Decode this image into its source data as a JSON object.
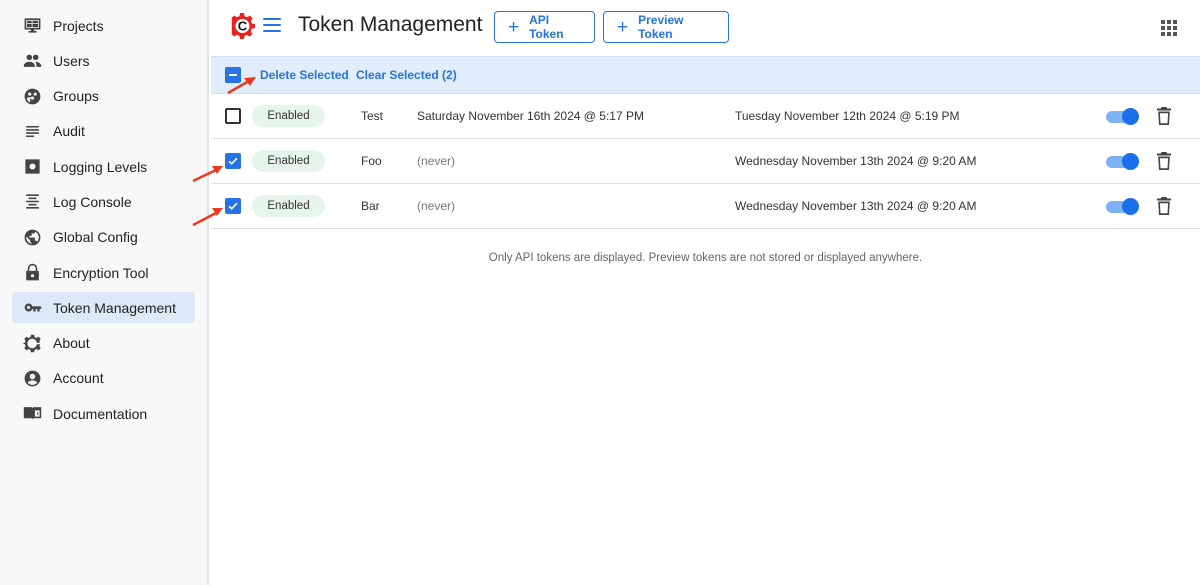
{
  "sidebar": {
    "items": [
      {
        "label": "Projects",
        "icon": "projects-icon",
        "active": false
      },
      {
        "label": "Users",
        "icon": "users-icon",
        "active": false
      },
      {
        "label": "Groups",
        "icon": "groups-icon",
        "active": false
      },
      {
        "label": "Audit",
        "icon": "audit-icon",
        "active": false
      },
      {
        "label": "Logging Levels",
        "icon": "logging-levels-icon",
        "active": false
      },
      {
        "label": "Log Console",
        "icon": "log-console-icon",
        "active": false
      },
      {
        "label": "Global Config",
        "icon": "globe-icon",
        "active": false
      },
      {
        "label": "Encryption Tool",
        "icon": "lock-icon",
        "active": false
      },
      {
        "label": "Token Management",
        "icon": "key-icon",
        "active": true
      },
      {
        "label": "About",
        "icon": "gear-logo-icon",
        "active": false
      },
      {
        "label": "Account",
        "icon": "account-icon",
        "active": false
      },
      {
        "label": "Documentation",
        "icon": "book-icon",
        "active": false
      }
    ]
  },
  "header": {
    "title": "Token Management",
    "api_token_label": "API Token",
    "preview_token_label": "Preview Token"
  },
  "bulk": {
    "delete_label": "Delete Selected",
    "clear_label": "Clear Selected (2)"
  },
  "tokens": [
    {
      "checked": false,
      "status": "Enabled",
      "name": "Test",
      "last_used": "Saturday November 16th 2024 @ 5:17 PM",
      "created": "Tuesday November 12th 2024 @ 5:19 PM",
      "enabled": true
    },
    {
      "checked": true,
      "status": "Enabled",
      "name": "Foo",
      "last_used": "(never)",
      "created": "Wednesday November 13th 2024 @ 9:20 AM",
      "enabled": true
    },
    {
      "checked": true,
      "status": "Enabled",
      "name": "Bar",
      "last_used": "(never)",
      "created": "Wednesday November 13th 2024 @ 9:20 AM",
      "enabled": true
    }
  ],
  "note": "Only API tokens are displayed. Preview tokens are not stored or displayed anywhere.",
  "colors": {
    "accent": "#2573e6",
    "logo": "#e8231f",
    "badge_bg": "#e6f5ec",
    "bulk_bar_bg": "#e1edfa",
    "active_nav_bg": "#dde9f7",
    "annotation_arrow": "#ea3a1e"
  }
}
